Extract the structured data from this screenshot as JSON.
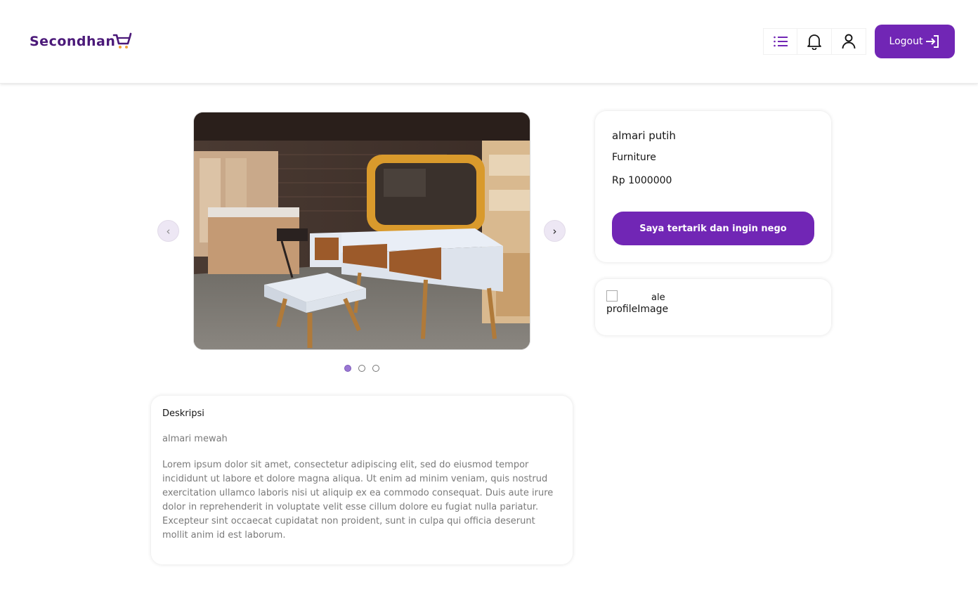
{
  "header": {
    "logo_text": "Secondhan",
    "logout_label": "Logout",
    "icons": [
      "list-icon",
      "bell-icon",
      "user-icon",
      "login-arrow-icon"
    ],
    "brand_color": "#7126b5",
    "logo_color": "#4b1979"
  },
  "carousel": {
    "prev_label": "‹",
    "next_label": "›",
    "slide_count": 3,
    "active_slide": 1
  },
  "product": {
    "name": "almari putih",
    "category": "Furniture",
    "price": "Rp 1000000",
    "nego_button_label": "Saya tertarik dan ingin nego"
  },
  "seller": {
    "name": "ale",
    "image_alt": "profileImage"
  },
  "description": {
    "title": "Deskripsi",
    "subtitle": "almari mewah",
    "body": "Lorem ipsum dolor sit amet, consectetur adipiscing elit, sed do eiusmod tempor incididunt ut labore et dolore magna aliqua. Ut enim ad minim veniam, quis nostrud exercitation ullamco laboris nisi ut aliquip ex ea commodo consequat. Duis aute irure dolor in reprehenderit in voluptate velit esse cillum dolore eu fugiat nulla pariatur. Excepteur sint occaecat cupidatat non proident, sunt in culpa qui officia deserunt mollit anim id est laborum."
  }
}
